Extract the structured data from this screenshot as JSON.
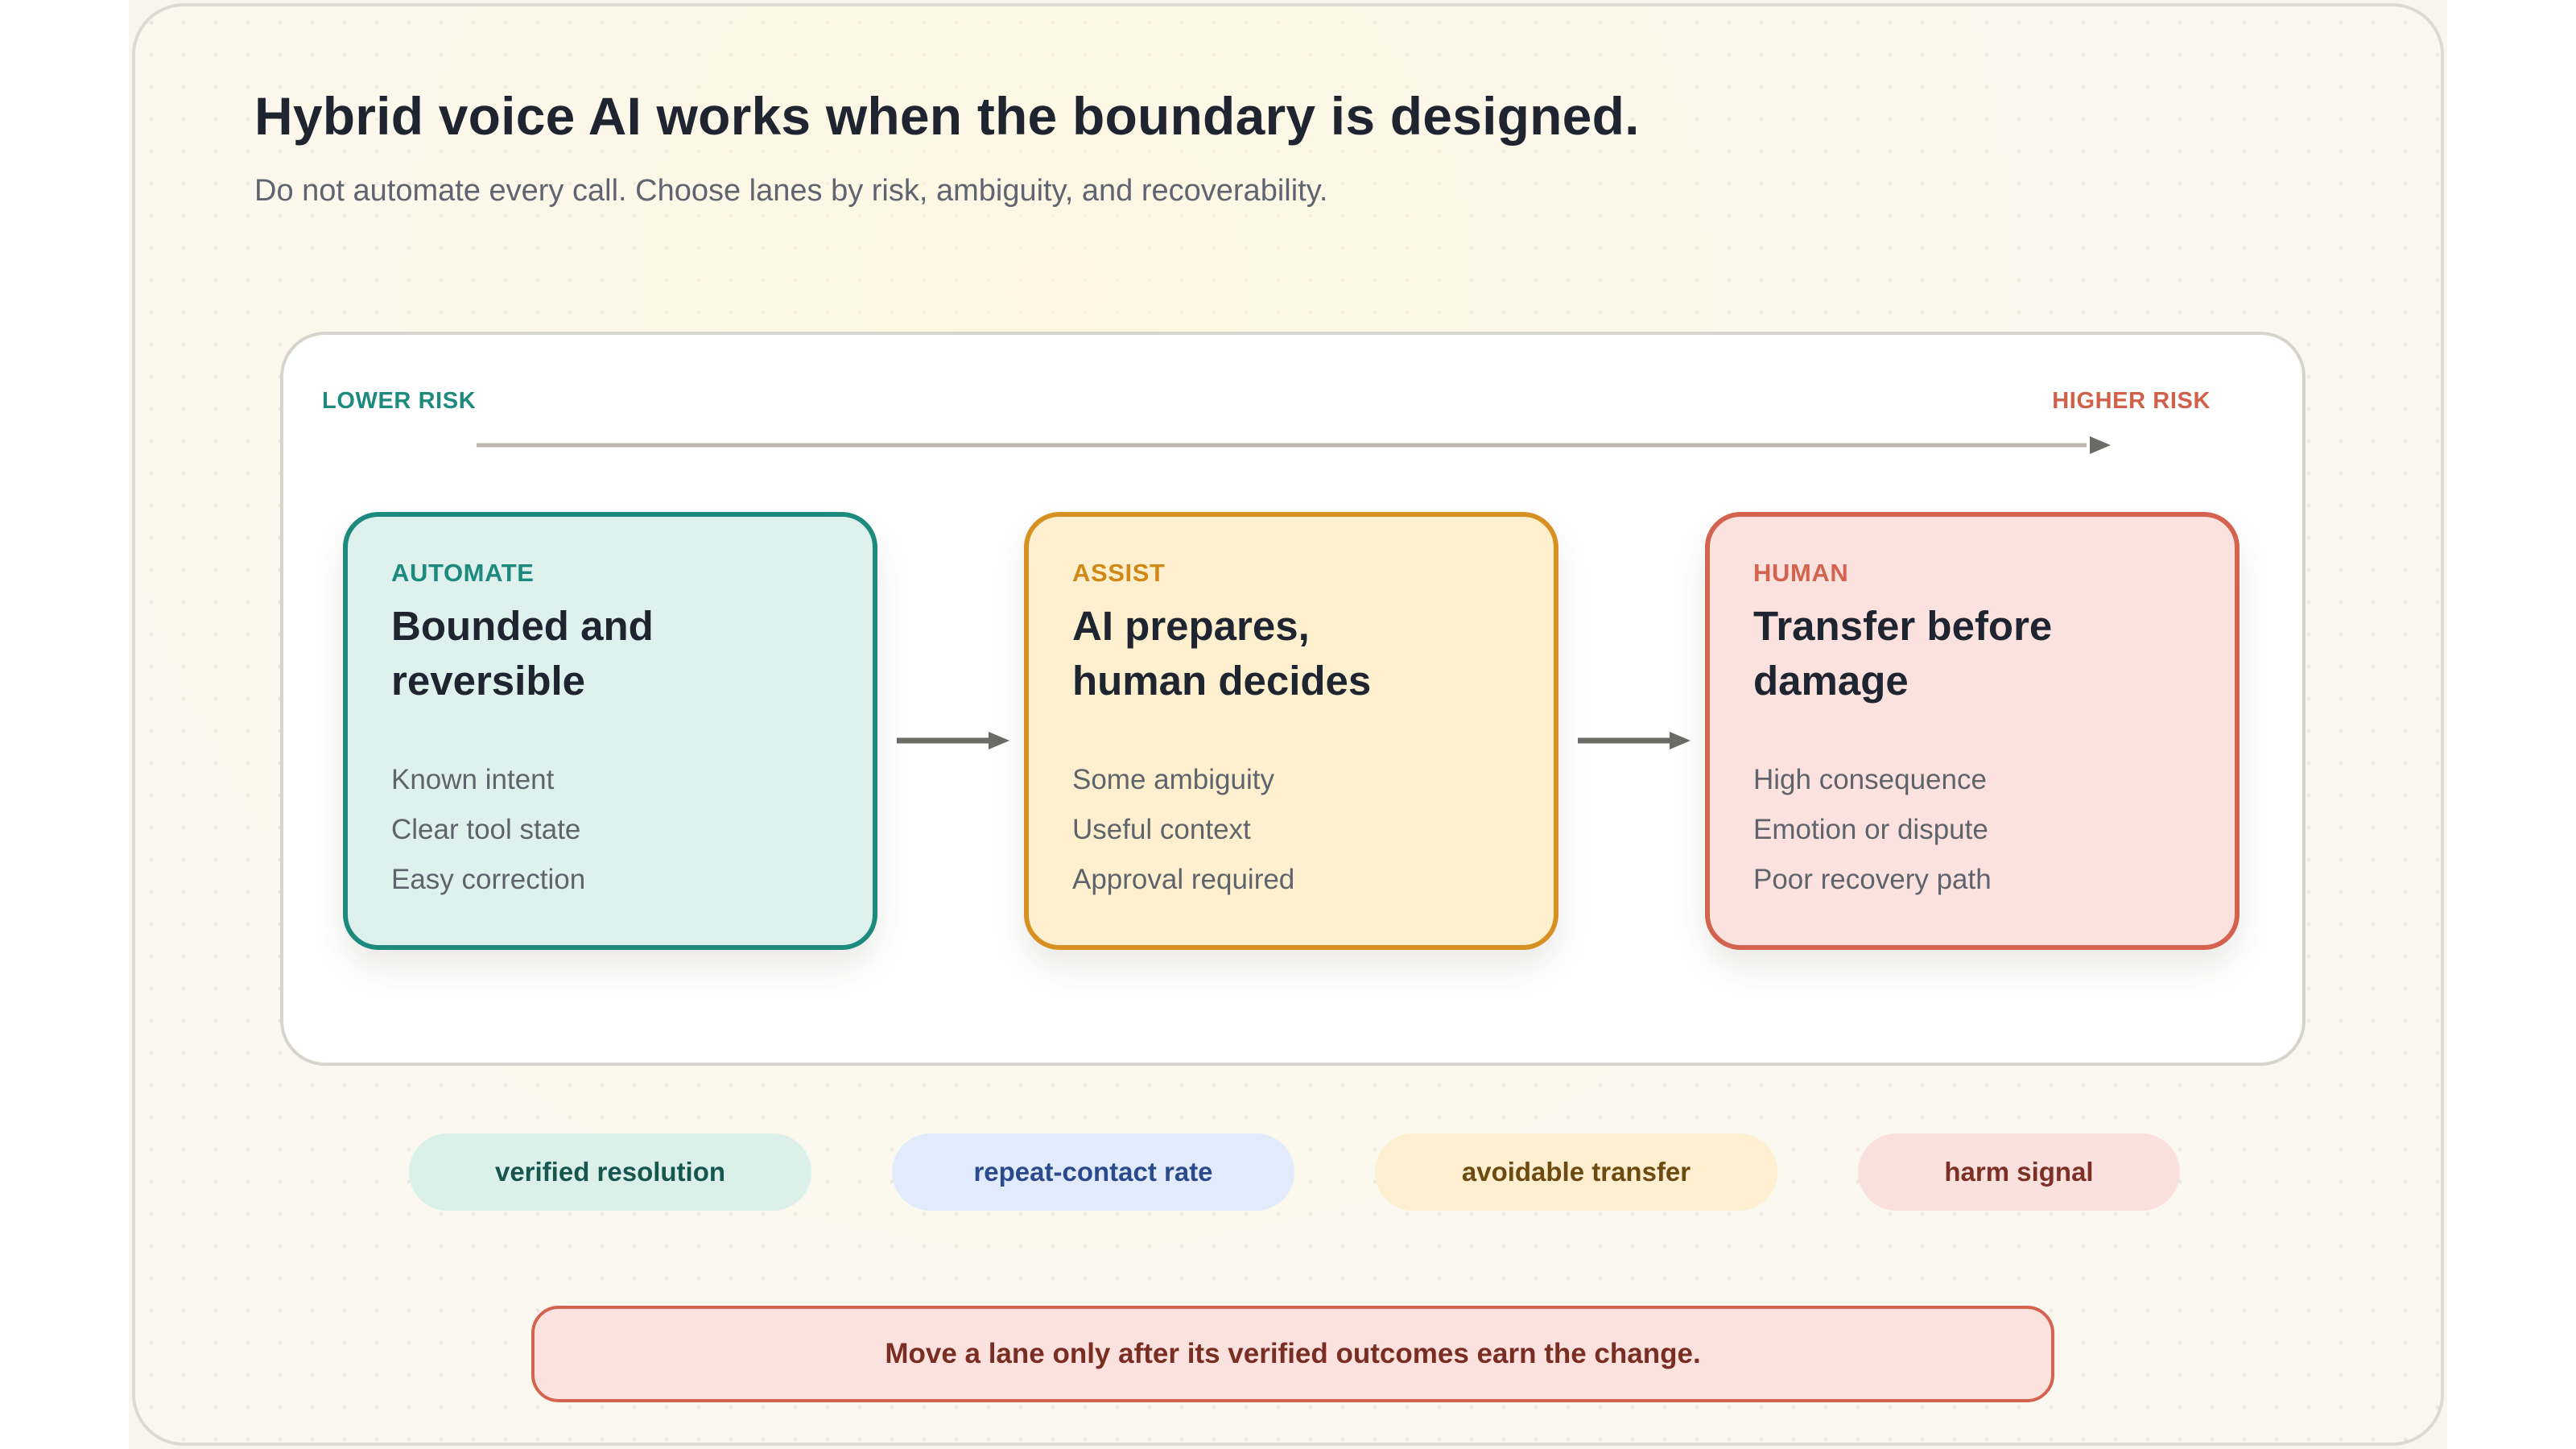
{
  "header": {
    "title": "Hybrid voice AI works when the boundary is designed.",
    "subtitle": "Do not automate every call. Choose lanes by risk, ambiguity, and recoverability."
  },
  "risk_scale": {
    "low_label": "LOWER RISK",
    "high_label": "HIGHER RISK"
  },
  "lanes": [
    {
      "kicker": "AUTOMATE",
      "title_lines": [
        "Bounded and",
        "reversible"
      ],
      "points": [
        "Known intent",
        "Clear tool state",
        "Easy correction"
      ]
    },
    {
      "kicker": "ASSIST",
      "title_lines": [
        "AI prepares,",
        "human decides"
      ],
      "points": [
        "Some ambiguity",
        "Useful context",
        "Approval required"
      ]
    },
    {
      "kicker": "HUMAN",
      "title_lines": [
        "Transfer before",
        "damage"
      ],
      "points": [
        "High consequence",
        "Emotion or dispute",
        "Poor recovery path"
      ]
    }
  ],
  "metrics": [
    "verified resolution",
    "repeat-contact rate",
    "avoidable transfer",
    "harm signal"
  ],
  "callout": "Move a lane only after its verified outcomes earn the change.",
  "colors": {
    "automate": "#1d8a7e",
    "assist": "#d79122",
    "human": "#d3634e",
    "axis": "#b9b7ae",
    "flow_arrow": "#6a6a66"
  }
}
